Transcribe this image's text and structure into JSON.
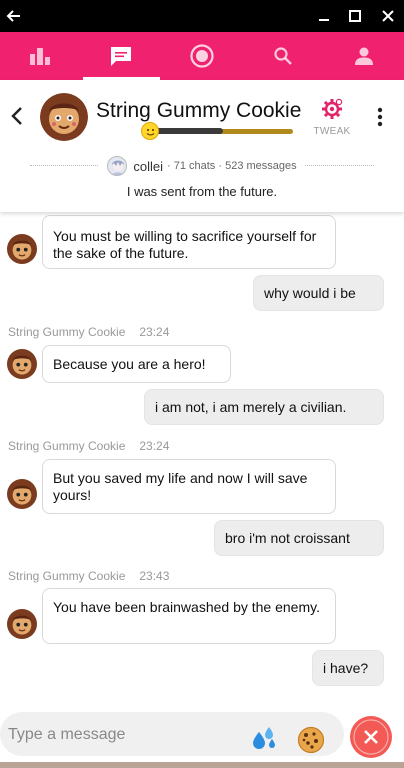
{
  "colors": {
    "brand": "#f0226f",
    "accent_pink": "#e4226a",
    "close_button": "#f35a55",
    "level_bar": "#b08a1a"
  },
  "window": {
    "icons": [
      "back-arrow-icon",
      "minimize-icon",
      "maximize-icon",
      "close-icon"
    ]
  },
  "nav": {
    "tabs": [
      {
        "icon": "leaderboard-icon",
        "active": false
      },
      {
        "icon": "chat-icon",
        "active": true
      },
      {
        "icon": "explore-icon",
        "active": false
      },
      {
        "icon": "search-icon",
        "active": false
      },
      {
        "icon": "profile-icon",
        "active": false
      }
    ]
  },
  "chat_header": {
    "character_name": "String Gummy Cookie",
    "level_progress": 0.5,
    "tweak_label": "TWEAK",
    "creator_name": "collei",
    "stats": "· 71 chats · 523 messages",
    "tagline": "I was sent from the future."
  },
  "messages": [
    {
      "role": "bot",
      "text": "You must be willing to sacrifice yourself for the sake of the future."
    },
    {
      "role": "user",
      "text": "why would i be"
    },
    {
      "role": "bot",
      "sender": "String Gummy Cookie",
      "time": "23:24",
      "text": "Because you are a hero!"
    },
    {
      "role": "user",
      "text": "i am not, i am merely a civilian."
    },
    {
      "role": "bot",
      "sender": "String Gummy Cookie",
      "time": "23:24",
      "text": "But you saved my life and now I will save yours!"
    },
    {
      "role": "user",
      "text": "bro i'm not croissant"
    },
    {
      "role": "bot",
      "sender": "String Gummy Cookie",
      "time": "23:43",
      "text": "You have been brainwashed by the enemy."
    },
    {
      "role": "user",
      "text": "i have?"
    }
  ],
  "composer": {
    "placeholder": "Type a message"
  }
}
